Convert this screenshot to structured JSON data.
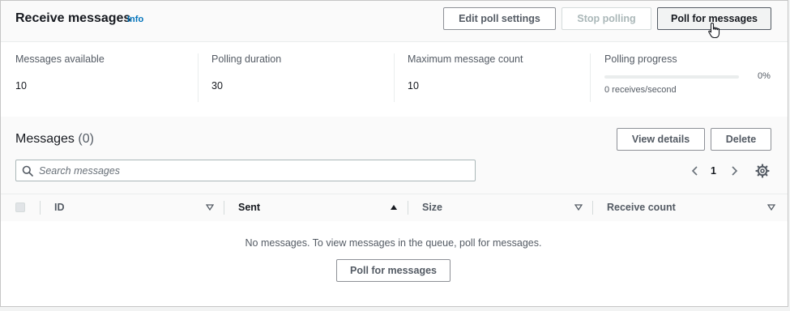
{
  "header": {
    "title": "Receive messages",
    "info_link": "Info",
    "edit_button": "Edit poll settings",
    "stop_button": "Stop polling",
    "poll_button": "Poll for messages"
  },
  "stats": {
    "messages_available_label": "Messages available",
    "messages_available_value": "10",
    "polling_duration_label": "Polling duration",
    "polling_duration_value": "30",
    "max_count_label": "Maximum message count",
    "max_count_value": "10",
    "progress_label": "Polling progress",
    "progress_percent": "0%",
    "progress_fraction": 0,
    "progress_rate": "0 receives/second"
  },
  "messages": {
    "title": "Messages",
    "count": "(0)",
    "view_details_button": "View details",
    "delete_button": "Delete",
    "search_placeholder": "Search messages",
    "current_page": "1",
    "columns": [
      "ID",
      "Sent",
      "Size",
      "Receive count"
    ],
    "empty_text": "No messages. To view messages in the queue, poll for messages.",
    "empty_poll_button": "Poll for messages"
  },
  "colors": {
    "accent": "#0073bb",
    "disabled_text": "#aab7b8",
    "border": "#8d9096"
  },
  "icons": [
    "search-icon",
    "chevron-left-icon",
    "chevron-right-icon",
    "settings-icon",
    "sort-icon",
    "sort-ascending-icon",
    "pointer-hand-icon"
  ]
}
